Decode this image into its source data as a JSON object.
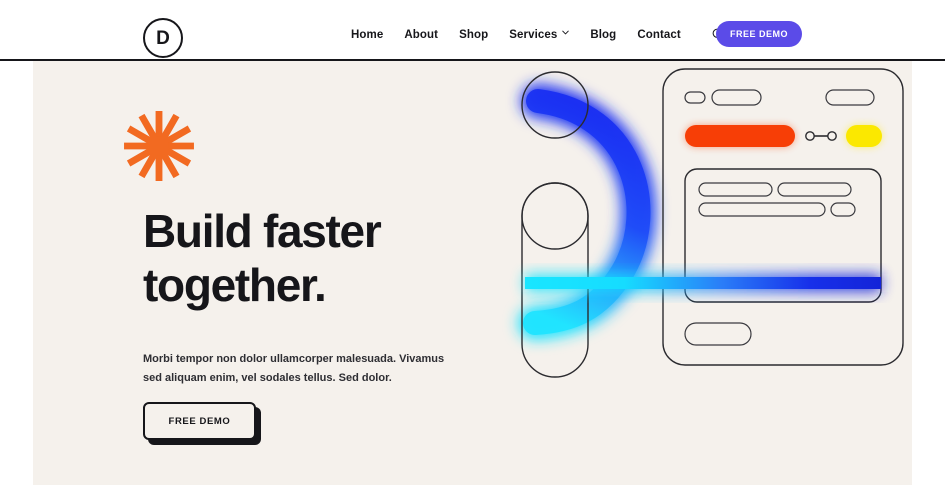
{
  "header": {
    "logo_text": "D",
    "logo_name": "divi-logo",
    "nav": [
      {
        "label": "Home",
        "has_dropdown": false
      },
      {
        "label": "About",
        "has_dropdown": false
      },
      {
        "label": "Shop",
        "has_dropdown": false
      },
      {
        "label": "Services",
        "has_dropdown": true
      },
      {
        "label": "Blog",
        "has_dropdown": false
      },
      {
        "label": "Contact",
        "has_dropdown": false
      }
    ],
    "search_icon": "search-icon",
    "cta_label": "FREE DEMO",
    "cta_color": "#5b4be8"
  },
  "hero": {
    "background_color": "#f5f1ec",
    "starburst_icon": "starburst-icon",
    "starburst_color": "#f26a21",
    "headline_line1": "Build faster",
    "headline_line2": "together.",
    "subcopy": "Morbi tempor non dolor ullamcorper malesuada. Vivamus sed aliquam enim, vel sodales tellus. Sed dolor.",
    "cta_label": "FREE DEMO"
  },
  "illustration": {
    "arc_gradient_start": "#1f3cf5",
    "arc_gradient_end": "#22e0ff",
    "beam_color": "#17e3ff",
    "beam_deep_color": "#1530e8",
    "card": {
      "top_row": [
        "pill-small",
        "pill-medium",
        "pill-right"
      ],
      "accent_bar_color": "#f73e06",
      "connector_icon": "node-link-icon",
      "chip_color": "#fbe800",
      "panel_rows": [
        [
          "pill-medium",
          "pill-medium"
        ],
        [
          "pill-long",
          "pill-small"
        ]
      ],
      "bottom_pill": "pill-footer"
    },
    "left_shapes": [
      "circle-outline-top",
      "circle-outline-mid",
      "pill-vertical-outline"
    ]
  }
}
